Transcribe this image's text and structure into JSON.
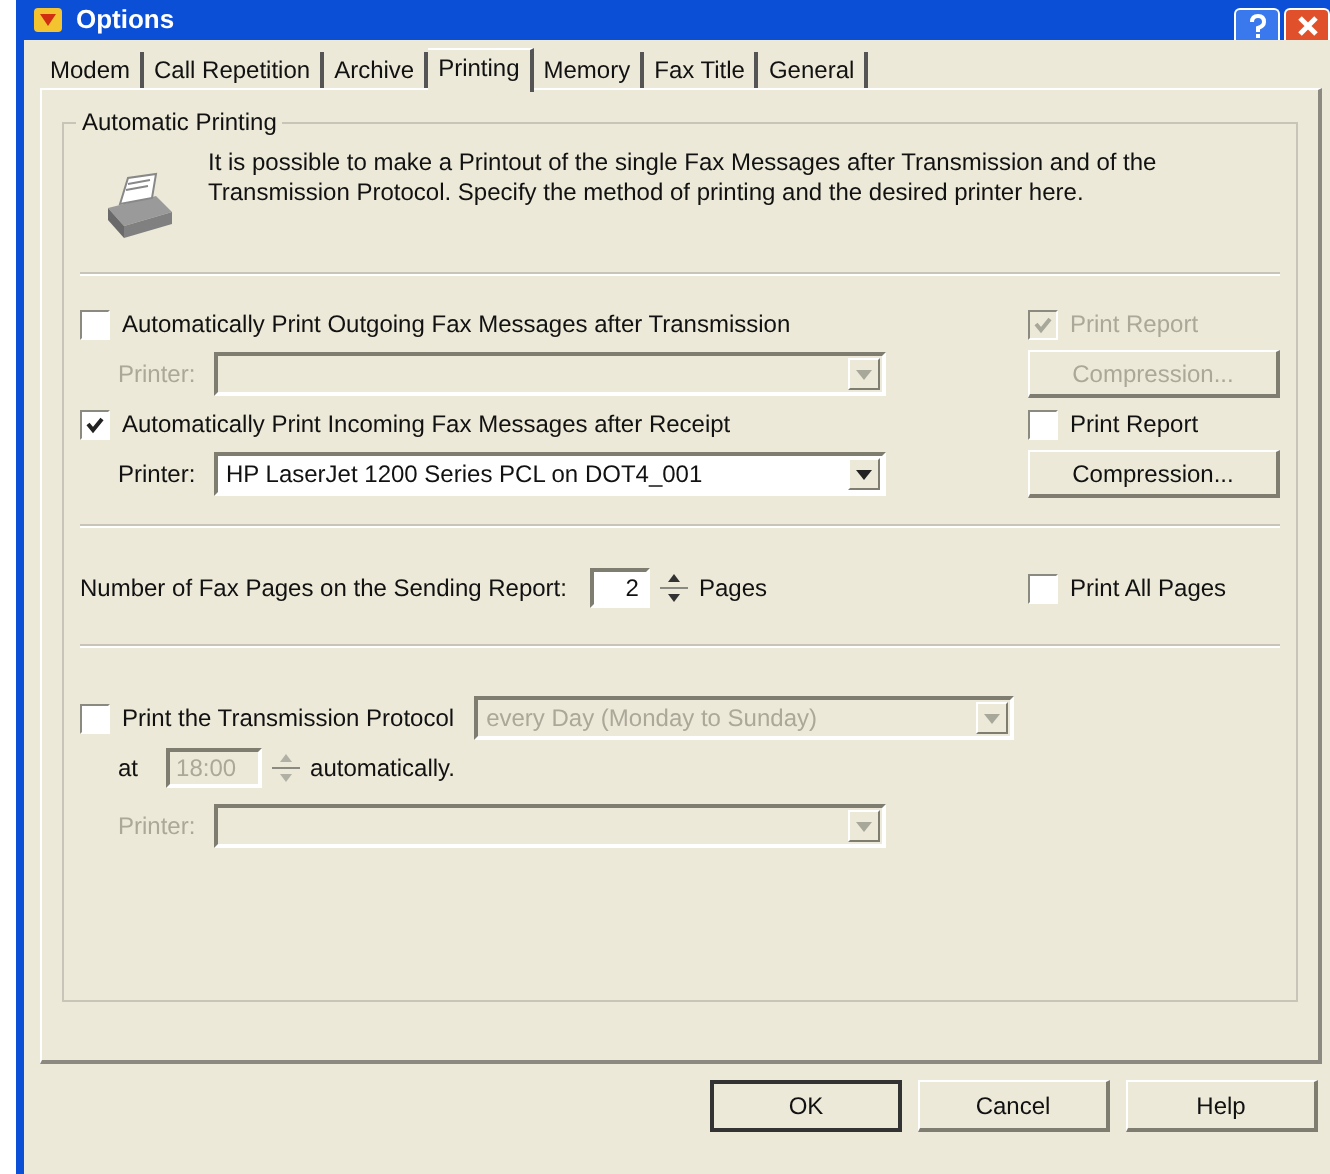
{
  "window": {
    "title": "Options"
  },
  "tabs": [
    {
      "label": "Modem",
      "selected": false
    },
    {
      "label": "Call Repetition",
      "selected": false
    },
    {
      "label": "Archive",
      "selected": false
    },
    {
      "label": "Printing",
      "selected": true
    },
    {
      "label": "Memory",
      "selected": false
    },
    {
      "label": "Fax Title",
      "selected": false
    },
    {
      "label": "General",
      "selected": false
    }
  ],
  "group": {
    "title": "Automatic Printing",
    "description": "It is possible to make a Printout of the single Fax Messages after Transmission and of the Transmission Protocol. Specify the method of printing and the desired printer here."
  },
  "print_jobs": [
    {
      "label": "Automatically Print Outgoing Fax Messages after Transmission",
      "checked": false,
      "printer_label": "Printer:",
      "printer_disabled": true,
      "report_label": "Print Report",
      "report_checked": true,
      "report_disabled": true,
      "compression_label": "Compression...",
      "compression_disabled": true
    },
    {
      "label": "Automatically Print Incoming Fax Messages after Receipt",
      "checked": true,
      "printer_label": "Printer:",
      "printer": "HP LaserJet 1200 Series PCL on DOT4_001",
      "printer_disabled": false,
      "report_label": "Print Report",
      "report_checked": false,
      "report_disabled": false,
      "compression_label": "Compression...",
      "compression_disabled": false
    }
  ],
  "pages": {
    "label": "Number of Fax Pages on the Sending Report:",
    "value": "2",
    "unit": "Pages",
    "print_all_label": "Print All Pages",
    "print_all_checked": false
  },
  "protocol": {
    "label": "Print the Transmission Protocol",
    "checked": false,
    "schedule": "every Day (Monday to Sunday)",
    "disabled": true,
    "at_label": "at",
    "time": "18:00",
    "suffix": "automatically.",
    "printer_label": "Printer:"
  },
  "buttons": [
    {
      "label": "OK",
      "default": true
    },
    {
      "label": "Cancel",
      "default": false
    },
    {
      "label": "Help",
      "default": false
    }
  ]
}
